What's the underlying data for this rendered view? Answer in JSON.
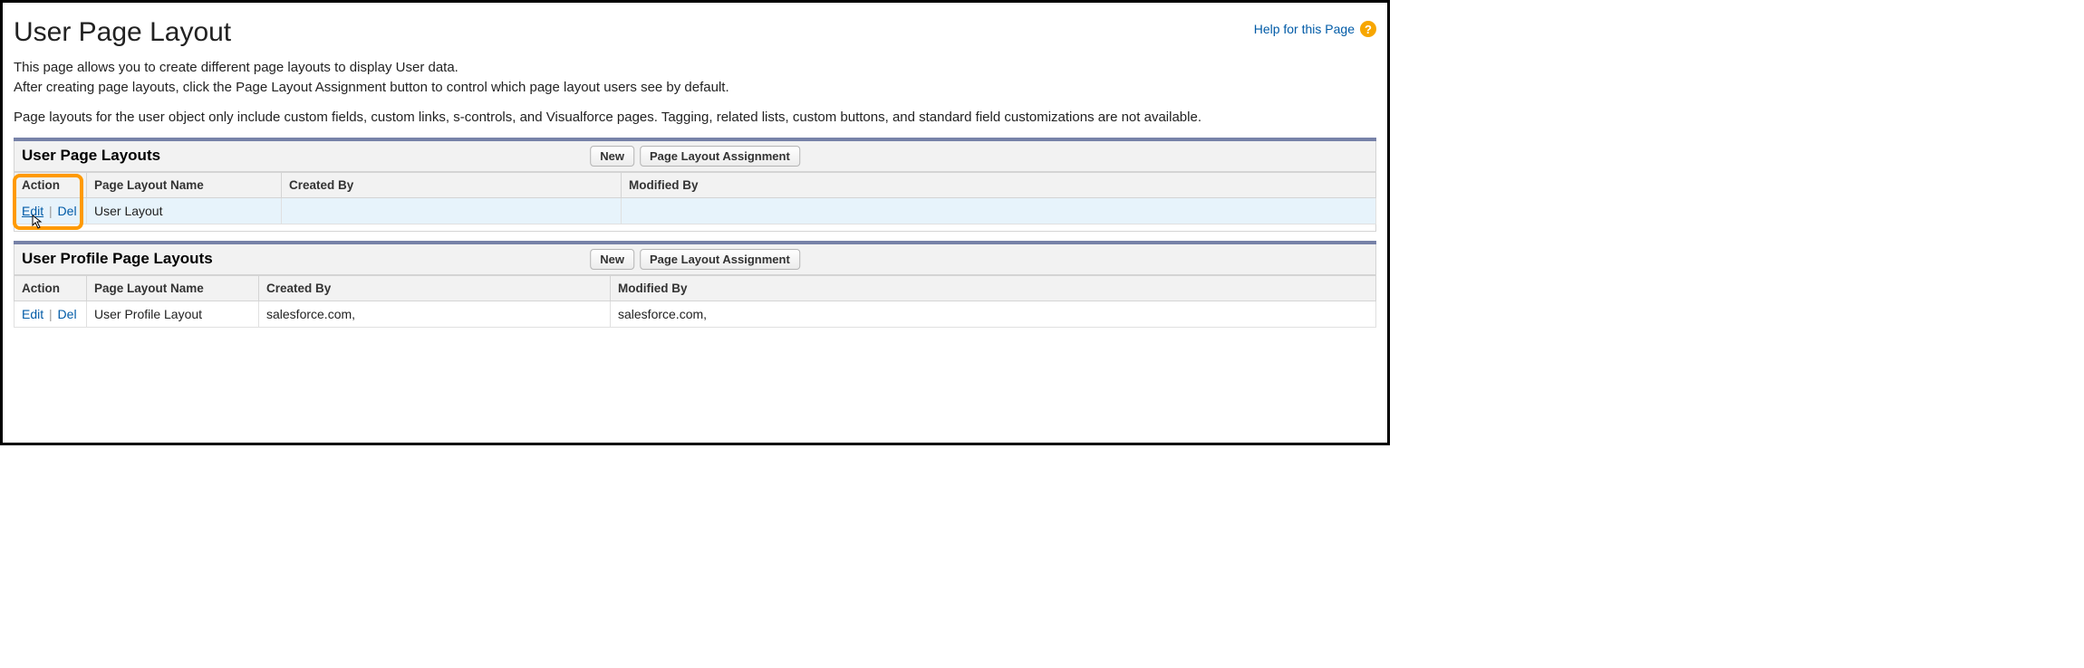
{
  "header": {
    "title": "User Page Layout",
    "help_link": "Help for this Page"
  },
  "description": {
    "line1": "This page allows you to create different page layouts to display User data.",
    "line2": "After creating page layouts, click the Page Layout Assignment button to control which page layout users see by default.",
    "line3": "Page layouts for the user object only include custom fields, custom links, s-controls, and Visualforce pages. Tagging, related lists, custom buttons, and standard field customizations are not available."
  },
  "buttons": {
    "new": "New",
    "assignment": "Page Layout Assignment"
  },
  "columns": {
    "action": "Action",
    "name": "Page Layout Name",
    "created": "Created By",
    "modified": "Modified By"
  },
  "actions": {
    "edit": "Edit",
    "del": "Del",
    "sep": "|"
  },
  "sections": [
    {
      "title": "User Page Layouts",
      "rows": [
        {
          "name": "User Layout",
          "created_by": "",
          "modified_by": ""
        }
      ]
    },
    {
      "title": "User Profile Page Layouts",
      "rows": [
        {
          "name": "User Profile Layout",
          "created_by": "salesforce.com,",
          "modified_by": "salesforce.com,"
        }
      ]
    }
  ]
}
